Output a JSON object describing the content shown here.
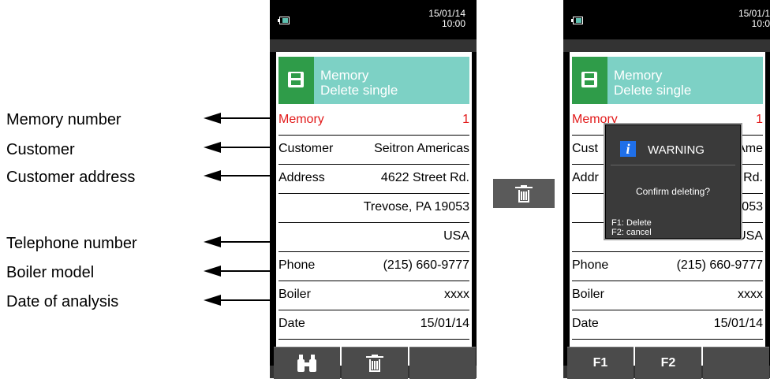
{
  "annotations": [
    {
      "label": "Memory number"
    },
    {
      "label": "Customer"
    },
    {
      "label": "Customer address"
    },
    {
      "label": "Telephone number"
    },
    {
      "label": "Boiler model"
    },
    {
      "label": "Date of analysis"
    }
  ],
  "left_device": {
    "date": "15/01/14",
    "time": "10:00",
    "title_line1": "Memory",
    "title_line2": "Delete single",
    "rows": [
      {
        "label": "Memory",
        "value": "1"
      },
      {
        "label": "Customer",
        "value": "Seitron Americas"
      },
      {
        "label": "Address",
        "value": "4622 Street Rd."
      },
      {
        "label": "",
        "value": "Trevose, PA 19053"
      },
      {
        "label": "",
        "value": "USA"
      },
      {
        "label": "Phone",
        "value": "(215) 660-9777"
      },
      {
        "label": "Boiler",
        "value": "xxxx"
      },
      {
        "label": "Date",
        "value": "15/01/14"
      }
    ],
    "fkeys": [
      "binoculars-icon",
      "trash-icon",
      ""
    ]
  },
  "center_button": {
    "icon": "trash-icon"
  },
  "right_device": {
    "date": "15/01/1",
    "time": "10:0",
    "title_line1": "Memory",
    "title_line2": "Delete single",
    "rows": [
      {
        "label": "Memory",
        "value": "1"
      },
      {
        "label": "Cust",
        "value": "Ame"
      },
      {
        "label": "Addr",
        "value": "Rd."
      },
      {
        "label": "",
        "value": ")053"
      },
      {
        "label": "",
        "value": "USA"
      },
      {
        "label": "Phone",
        "value": "(215) 660-9777"
      },
      {
        "label": "Boiler",
        "value": "xxxx"
      },
      {
        "label": "Date",
        "value": "15/01/14"
      }
    ],
    "fkeys": [
      "F1",
      "F2",
      ""
    ]
  },
  "popup": {
    "icon": "info-icon",
    "icon_glyph": "i",
    "title": "WARNING",
    "message": "Confirm deleting?",
    "f1": "F1: Delete",
    "f2": "F2: cancel"
  },
  "colors": {
    "accent_red": "#e21a1a",
    "title_teal": "#7dd1c5",
    "icon_green": "#2f9c49",
    "info_blue": "#1f6fe8"
  }
}
